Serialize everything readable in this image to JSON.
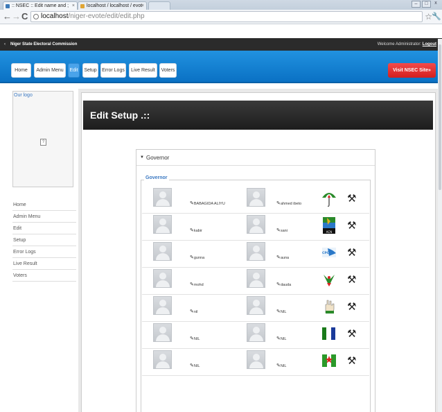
{
  "browser": {
    "tabs": [
      {
        "title": ":: NSEC :: Edit name and ;"
      },
      {
        "title": "localhost / localhost / evot"
      },
      {
        "title": ""
      }
    ],
    "url_host": "localhost",
    "url_path": "/niger-evote/edit/edit.php"
  },
  "site": {
    "brand": "Niger State Electoral Commission",
    "welcome": "Welcome Administrator:",
    "logout": "Logout",
    "nav": [
      "Home",
      "Admin Menu",
      "Edit",
      "Setup",
      "Error Logs",
      "Live Result",
      "Voters"
    ],
    "visit": "Visit NSEC Site»"
  },
  "sidebar": {
    "logo_alt": "Our logo",
    "items": [
      "Home",
      "Admin Menu",
      "Edit",
      "Setup",
      "Error Logs",
      "Live Result",
      "Voters"
    ]
  },
  "main": {
    "title": "Edit Setup .::",
    "section": "Governor",
    "legend": "Governor",
    "rows": [
      {
        "c1": "BABAGIDA ALIYU",
        "c2": "ahmed ibeto",
        "party_icon": "umbrella-logo-icon"
      },
      {
        "c1": "kabir",
        "c2": "sani",
        "party_icon": "acn-logo-icon"
      },
      {
        "c1": "gunna",
        "c2": "auna",
        "party_icon": "cpc-logo-icon"
      },
      {
        "c1": "mohd",
        "c2": "dauda",
        "party_icon": "eagle-logo-icon"
      },
      {
        "c1": "nil",
        "c2": "NIL",
        "party_icon": "hand-logo-icon"
      },
      {
        "c1": "NIL",
        "c2": "NIL",
        "party_icon": "flag-logo-icon"
      },
      {
        "c1": "NIL",
        "c2": "NIL",
        "party_icon": "star-flag-logo-icon"
      }
    ]
  }
}
